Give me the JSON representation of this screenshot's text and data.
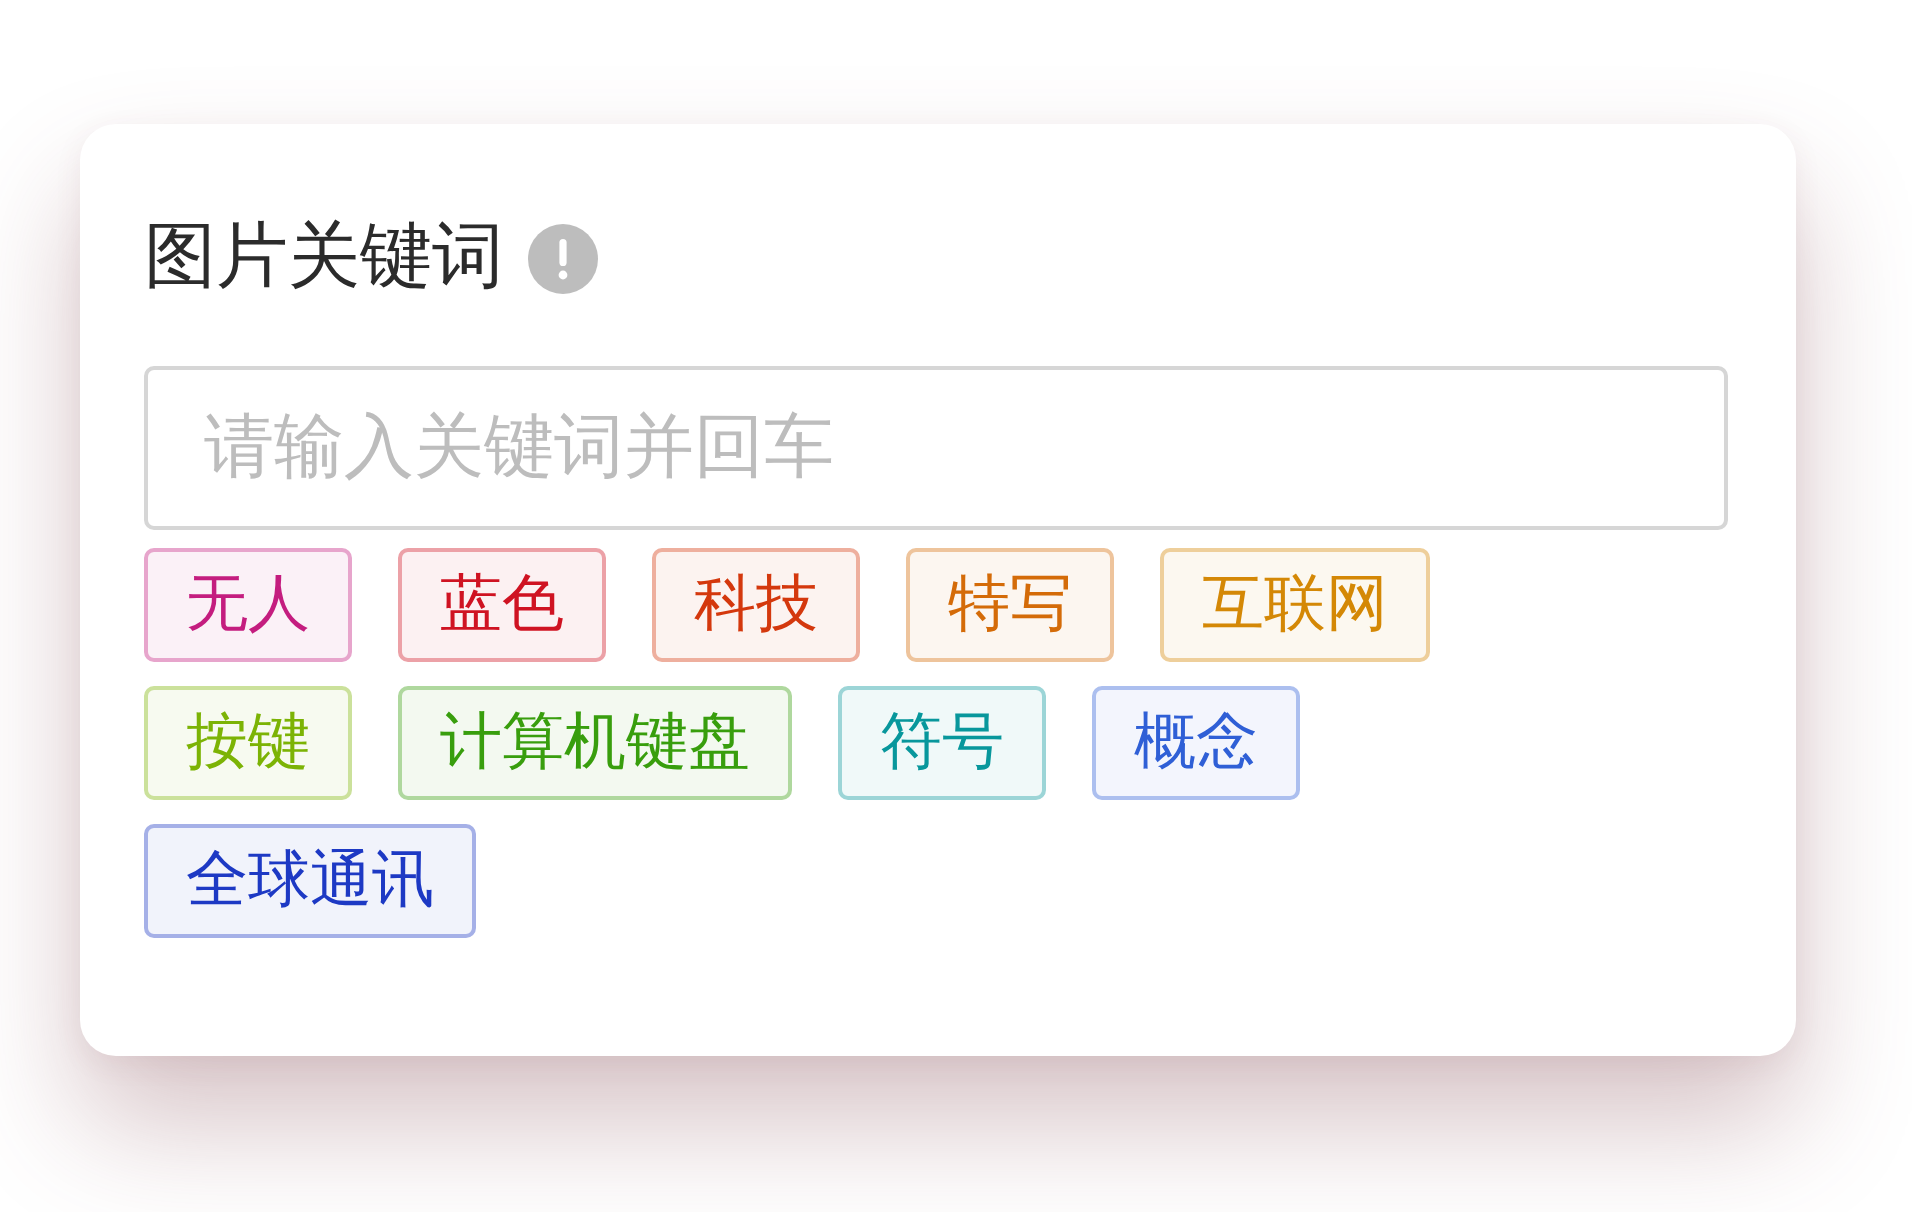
{
  "field": {
    "label": "图片关键词",
    "placeholder": "请输入关键词并回车"
  },
  "tags": [
    {
      "text": "无人",
      "color": "#c41d7f"
    },
    {
      "text": "蓝色",
      "color": "#cf1322"
    },
    {
      "text": "科技",
      "color": "#d4380d"
    },
    {
      "text": "特写",
      "color": "#d46b08"
    },
    {
      "text": "互联网",
      "color": "#d48806"
    },
    {
      "text": "按键",
      "color": "#7cb305"
    },
    {
      "text": "计算机键盘",
      "color": "#389e0d"
    },
    {
      "text": "符号",
      "color": "#08979c"
    },
    {
      "text": "概念",
      "color": "#2f5fd6"
    },
    {
      "text": "全球通讯",
      "color": "#1d39c4"
    }
  ]
}
